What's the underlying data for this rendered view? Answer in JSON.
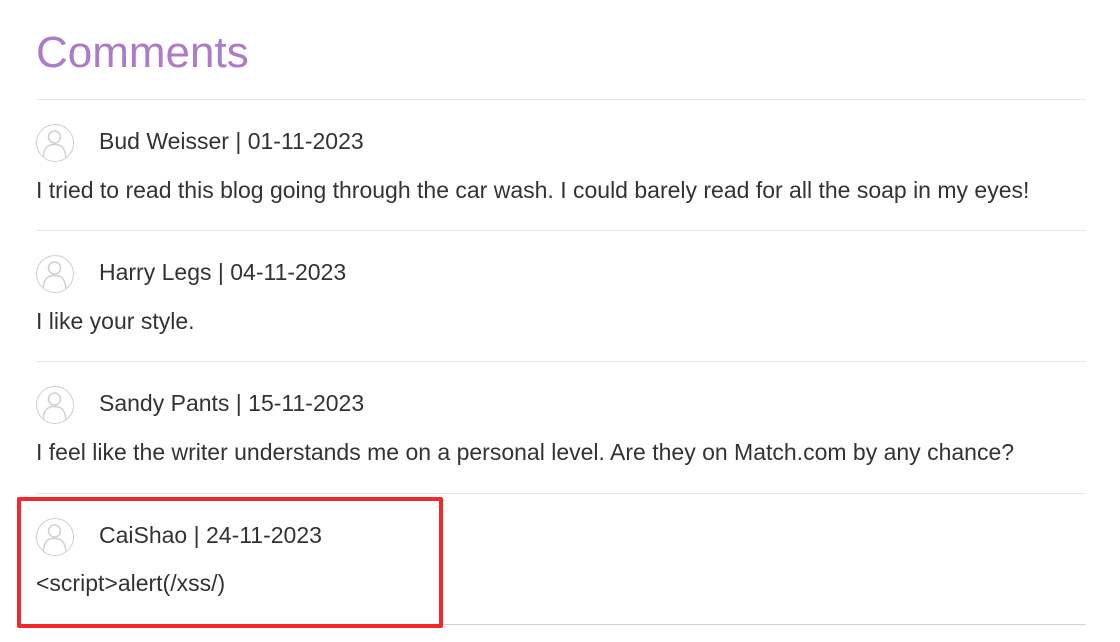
{
  "section": {
    "title": "Comments"
  },
  "comments": [
    {
      "meta": "Bud Weisser | 01-11-2023",
      "text": "I tried to read this blog going through the car wash. I could barely read for all the soap in my eyes!",
      "avatar_icon": "user-avatar-icon"
    },
    {
      "meta": "Harry Legs | 04-11-2023",
      "text": "I like your style.",
      "avatar_icon": "user-avatar-icon"
    },
    {
      "meta": "Sandy Pants | 15-11-2023",
      "text": "I feel like the writer understands me on a personal level. Are they on Match.com by any chance?",
      "avatar_icon": "user-avatar-icon"
    },
    {
      "meta": "CaiShao | 24-11-2023",
      "text": "<script>alert(/xss/)",
      "avatar_icon": "user-avatar-icon",
      "highlighted": true
    }
  ],
  "colors": {
    "heading": "#ae7bc7",
    "text": "#333333",
    "divider": "#e6e6e6",
    "highlight_border": "#f32828"
  }
}
